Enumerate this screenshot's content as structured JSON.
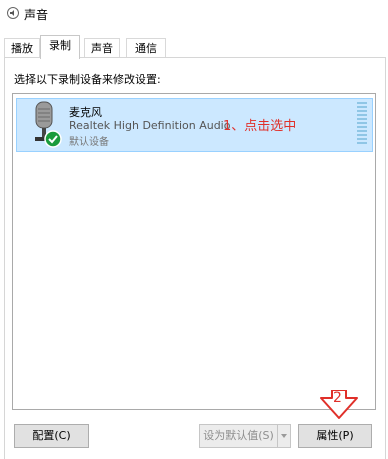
{
  "window": {
    "title": "声音"
  },
  "tabs": [
    {
      "label": "播放"
    },
    {
      "label": "录制",
      "active": true
    },
    {
      "label": "声音"
    },
    {
      "label": "通信"
    }
  ],
  "instruction": "选择以下录制设备来修改设置:",
  "device": {
    "name": "麦克风",
    "driver": "Realtek High Definition Audio",
    "status": "默认设备",
    "icon": "microphone-icon",
    "status_icon": "check-icon"
  },
  "annotations": {
    "step1": "1、点击选中",
    "step2": "2",
    "color": "#e0302a"
  },
  "buttons": {
    "configure": "配置(C)",
    "set_default": "设为默认值(S)",
    "properties": "属性(P)"
  },
  "colors": {
    "selection": "#cce8ff",
    "selection_border": "#99d1ff"
  }
}
